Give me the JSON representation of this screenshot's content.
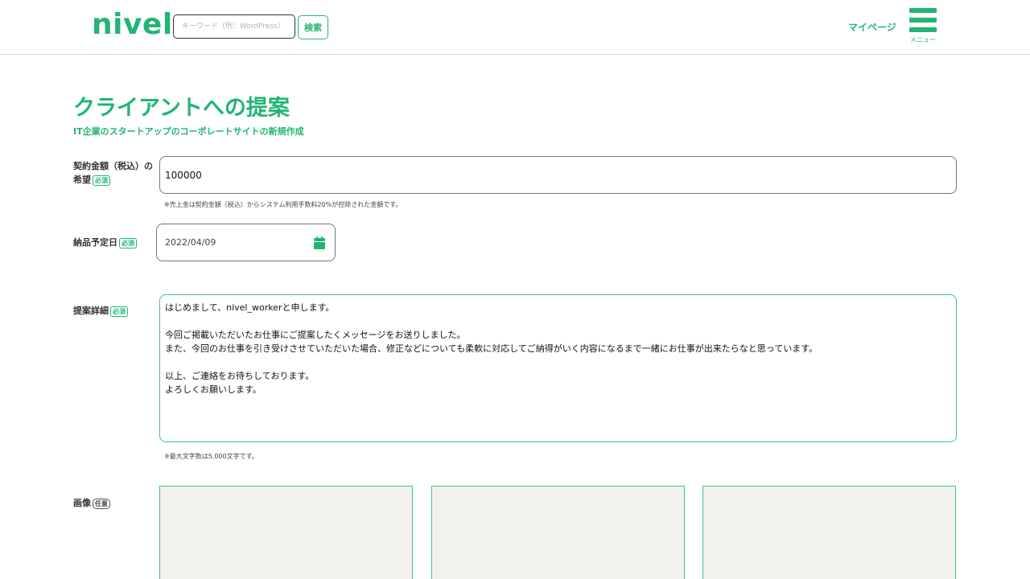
{
  "header": {
    "logo": "nivel",
    "search_placeholder": "キーワード（例：WordPress）",
    "search_button": "検索",
    "mypage": "マイページ",
    "menu_label": "メニュー"
  },
  "page": {
    "title": "クライアントへの提案",
    "subtitle": "IT企業のスタートアップのコーポレートサイトの新規作成"
  },
  "form": {
    "amount": {
      "label_line1": "契約金額（税込）の",
      "label_line2": "希望",
      "badge": "必須",
      "value": "100000",
      "note": "※売上金は契約金額（税込）からシステム利用手数料20%が控除された金額です。"
    },
    "delivery": {
      "label": "納品予定日",
      "badge": "必須",
      "value": "2022/04/09"
    },
    "detail": {
      "label": "提案詳細",
      "badge": "必須",
      "lines": [
        "はじめまして、nivel_workerと申します。",
        "",
        "今回ご掲載いただいたお仕事にご提案したくメッセージをお送りしました。",
        "また、今回のお仕事を引き受けさせていただいた場合、修正などについても柔軟に対応してご納得がいく内容になるまで一緒にお仕事が出来たらなと思っています。",
        "",
        "以上、ご連絡をお待ちしております。",
        "よろしくお願いします。"
      ],
      "note": "※最大文字数は5,000文字です。"
    },
    "images": {
      "label": "画像",
      "badge": "任意"
    }
  },
  "colors": {
    "accent": "#22b573",
    "slot_bg": "#f2f1ed"
  },
  "icons": [
    "menu-icon",
    "calendar-icon"
  ]
}
